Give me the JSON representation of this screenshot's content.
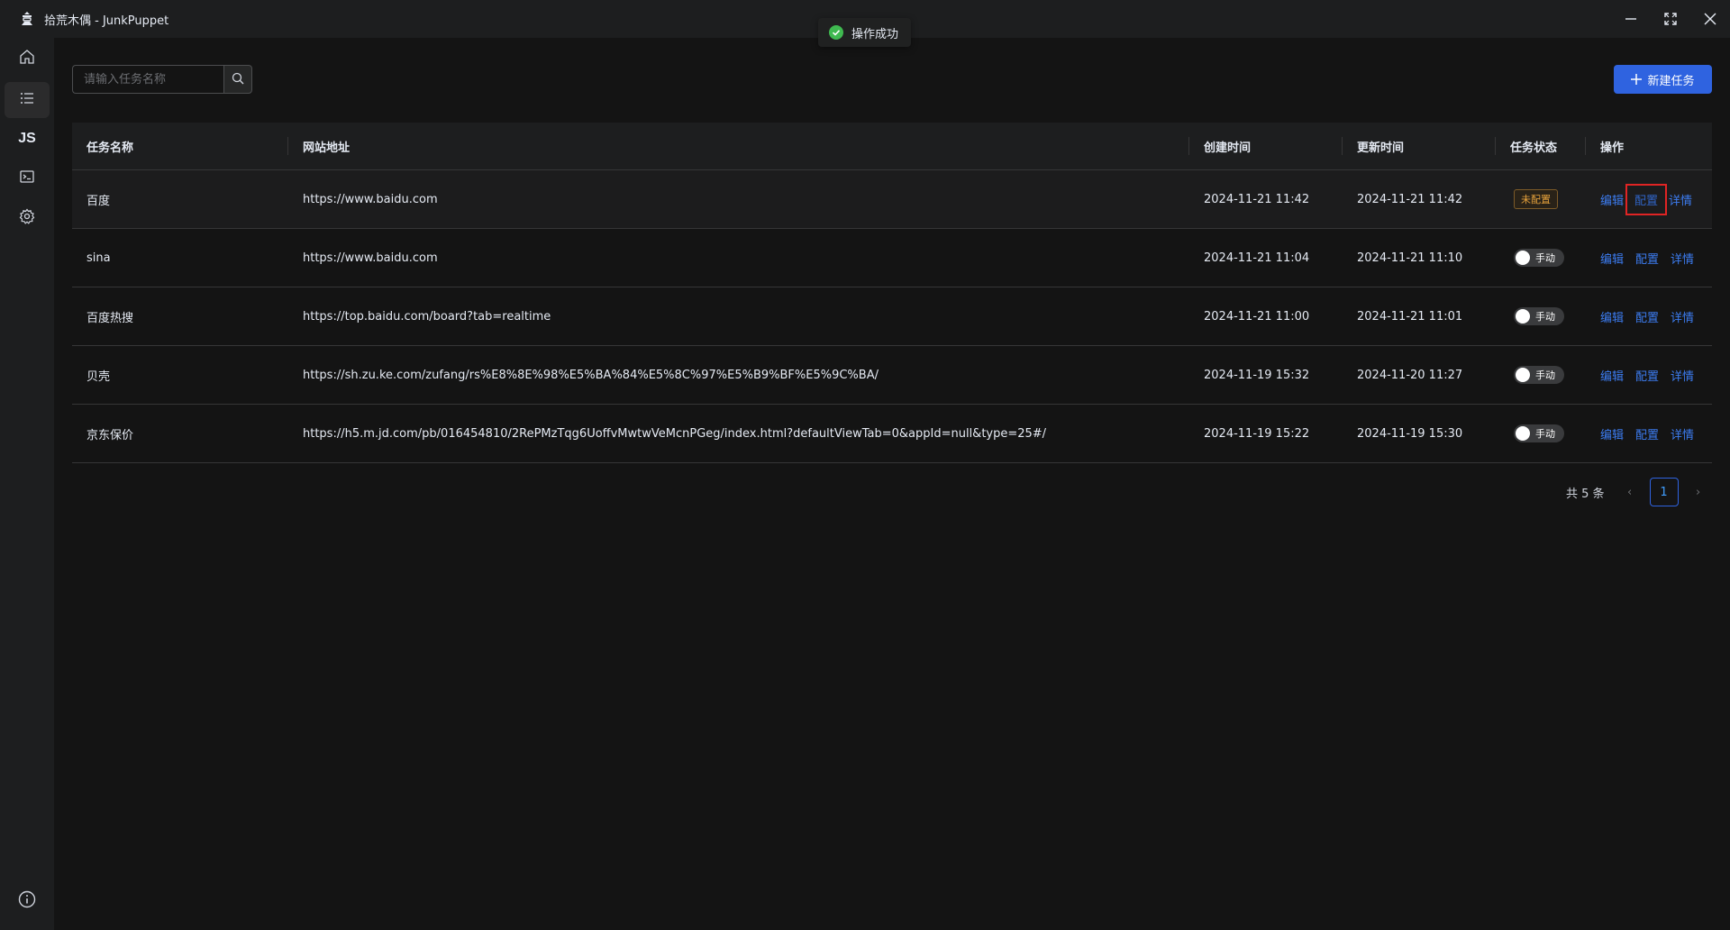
{
  "window": {
    "title": "拾荒木偶 - JunkPuppet"
  },
  "toast": {
    "message": "操作成功",
    "color": "#3fb950"
  },
  "sidebar": {
    "items": [
      {
        "icon": "home-icon"
      },
      {
        "icon": "list-icon",
        "active": true
      },
      {
        "label": "JS"
      },
      {
        "icon": "terminal-icon"
      },
      {
        "icon": "gear-icon"
      }
    ],
    "bottom_icon": "info-icon"
  },
  "search": {
    "placeholder": "请输入任务名称",
    "value": ""
  },
  "toolbar": {
    "new_task_label": "新建任务"
  },
  "table": {
    "columns": [
      "任务名称",
      "网站地址",
      "创建时间",
      "更新时间",
      "任务状态",
      "操作"
    ],
    "rows": [
      {
        "name": "百度",
        "url": "https://www.baidu.com",
        "created": "2024-11-21 11:42",
        "updated": "2024-11-21 11:42",
        "status": "未配置",
        "status_type": "tag"
      },
      {
        "name": "sina",
        "url": "https://www.baidu.com",
        "created": "2024-11-21 11:04",
        "updated": "2024-11-21 11:10",
        "status": "手动",
        "status_type": "switch"
      },
      {
        "name": "百度热搜",
        "url": "https://top.baidu.com/board?tab=realtime",
        "created": "2024-11-21 11:00",
        "updated": "2024-11-21 11:01",
        "status": "手动",
        "status_type": "switch"
      },
      {
        "name": "贝壳",
        "url": "https://sh.zu.ke.com/zufang/rs%E8%8E%98%E5%BA%84%E5%8C%97%E5%B9%BF%E5%9C%BA/",
        "created": "2024-11-19 15:32",
        "updated": "2024-11-20 11:27",
        "status": "手动",
        "status_type": "switch"
      },
      {
        "name": "京东保价",
        "url": "https://h5.m.jd.com/pb/016454810/2RePMzTqg6UoffvMwtwVeMcnPGeg/index.html?defaultViewTab=0&appId=null&type=25#/",
        "created": "2024-11-19 15:22",
        "updated": "2024-11-19 15:30",
        "status": "手动",
        "status_type": "switch"
      }
    ],
    "actions": {
      "edit": "编辑",
      "config": "配置",
      "detail": "详情"
    }
  },
  "pagination": {
    "total_label": "共 5 条",
    "current_page": "1",
    "prev": "‹",
    "next": "›"
  },
  "colors": {
    "accent": "#2f63e0",
    "link": "#3c7cf0",
    "warning": "#e6a23c",
    "highlight_box": "#e02424"
  }
}
